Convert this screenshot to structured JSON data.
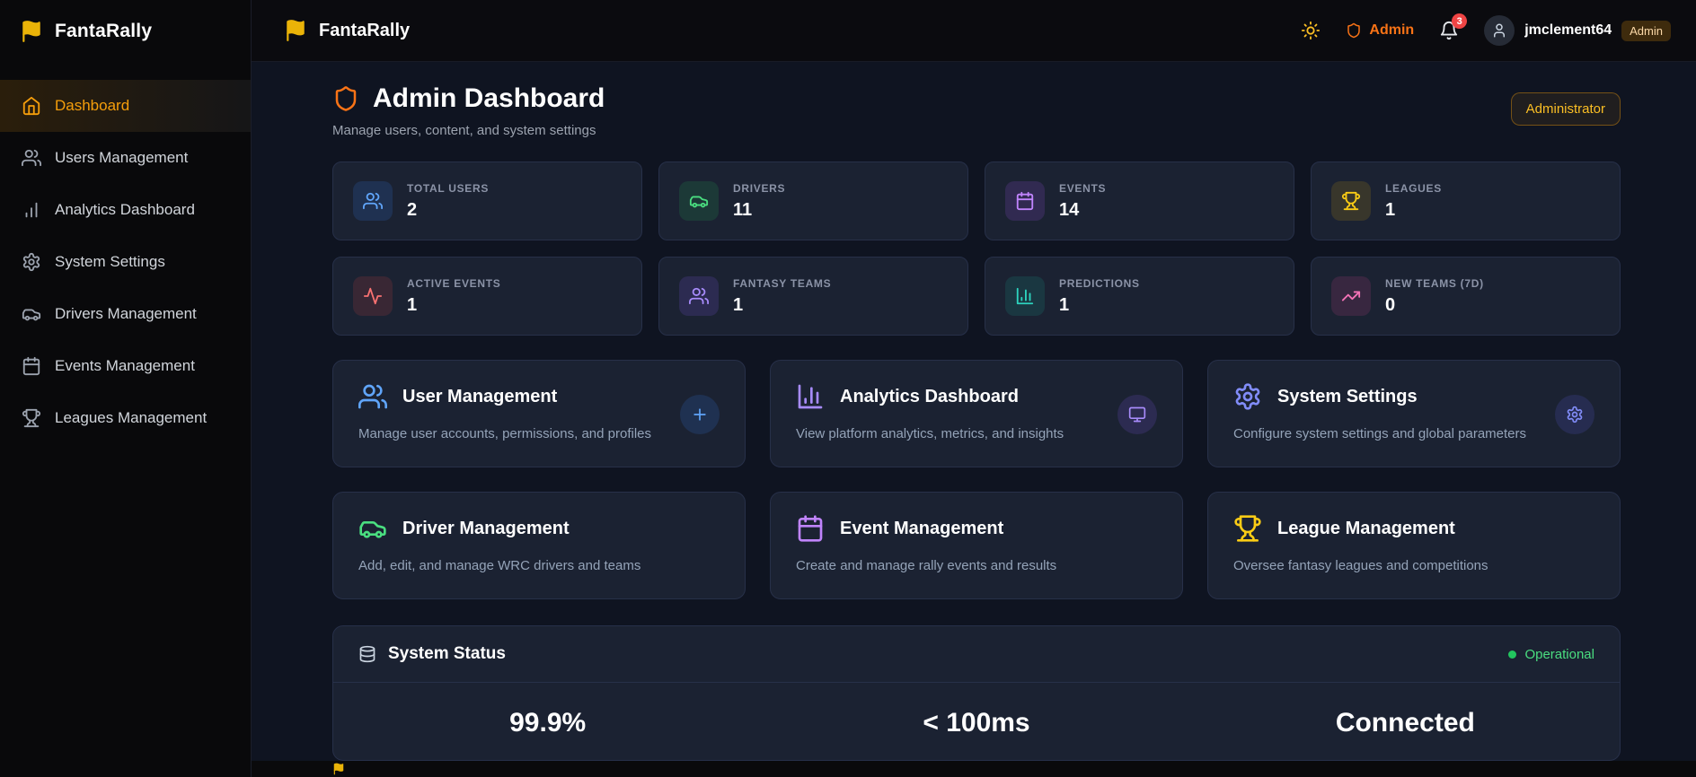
{
  "theme": {
    "accent_orange": "#f59e0b",
    "background": "#0f1421",
    "card_background": "#1b2232",
    "sidebar_background": "#09090b",
    "status_green": "#22c55e",
    "notification_red": "#ef4444"
  },
  "brand": {
    "name": "FantaRally"
  },
  "sidebar": {
    "items": [
      {
        "label": "Dashboard",
        "icon": "home-icon",
        "active": true
      },
      {
        "label": "Users Management",
        "icon": "users-icon",
        "active": false
      },
      {
        "label": "Analytics Dashboard",
        "icon": "bar-chart-icon",
        "active": false
      },
      {
        "label": "System Settings",
        "icon": "gear-icon",
        "active": false
      },
      {
        "label": "Drivers Management",
        "icon": "car-icon",
        "active": false
      },
      {
        "label": "Events Management",
        "icon": "calendar-icon",
        "active": false
      },
      {
        "label": "Leagues Management",
        "icon": "trophy-icon",
        "active": false
      }
    ]
  },
  "topbar": {
    "title": "FantaRally",
    "theme_toggle_icon": "sun-icon",
    "admin_link": "Admin",
    "notification_count": "3",
    "user": {
      "name": "jmclement64",
      "badge": "Admin"
    }
  },
  "page": {
    "title": "Admin Dashboard",
    "subtitle": "Manage users, content, and system settings",
    "role_badge": "Administrator"
  },
  "stats": [
    {
      "label": "TOTAL USERS",
      "value": "2",
      "icon": "users-icon",
      "color": "#60a5fa"
    },
    {
      "label": "DRIVERS",
      "value": "11",
      "icon": "car-icon",
      "color": "#4ade80"
    },
    {
      "label": "EVENTS",
      "value": "14",
      "icon": "calendar-icon",
      "color": "#c084fc"
    },
    {
      "label": "LEAGUES",
      "value": "1",
      "icon": "trophy-icon",
      "color": "#facc15"
    },
    {
      "label": "ACTIVE EVENTS",
      "value": "1",
      "icon": "activity-icon",
      "color": "#f87171"
    },
    {
      "label": "FANTASY TEAMS",
      "value": "1",
      "icon": "users-icon",
      "color": "#a78bfa"
    },
    {
      "label": "PREDICTIONS",
      "value": "1",
      "icon": "bar-chart-icon",
      "color": "#2dd4bf"
    },
    {
      "label": "NEW TEAMS (7D)",
      "value": "0",
      "icon": "trending-up-icon",
      "color": "#f472b6"
    }
  ],
  "management_cards": [
    {
      "title": "User Management",
      "description": "Manage user accounts, permissions, and profiles",
      "icon": "users-icon",
      "color": "#3b82f6",
      "action_icon": "plus-icon"
    },
    {
      "title": "Analytics Dashboard",
      "description": "View platform analytics, metrics, and insights",
      "icon": "bar-chart-icon",
      "color": "#8b5cf6",
      "action_icon": "monitor-icon"
    },
    {
      "title": "System Settings",
      "description": "Configure system settings and global parameters",
      "icon": "gear-icon",
      "color": "#6366f1",
      "action_icon": "gear-icon"
    },
    {
      "title": "Driver Management",
      "description": "Add, edit, and manage WRC drivers and teams",
      "icon": "car-icon",
      "color": "#22c55e"
    },
    {
      "title": "Event Management",
      "description": "Create and manage rally events and results",
      "icon": "calendar-icon",
      "color": "#a855f7"
    },
    {
      "title": "League Management",
      "description": "Oversee fantasy leagues and competitions",
      "icon": "trophy-icon",
      "color": "#eab308"
    }
  ],
  "system_status": {
    "title": "System Status",
    "status_label": "Operational",
    "status_color": "#22c55e",
    "metrics": [
      {
        "value": "99.9%"
      },
      {
        "value": "< 100ms"
      },
      {
        "value": "Connected"
      }
    ]
  }
}
